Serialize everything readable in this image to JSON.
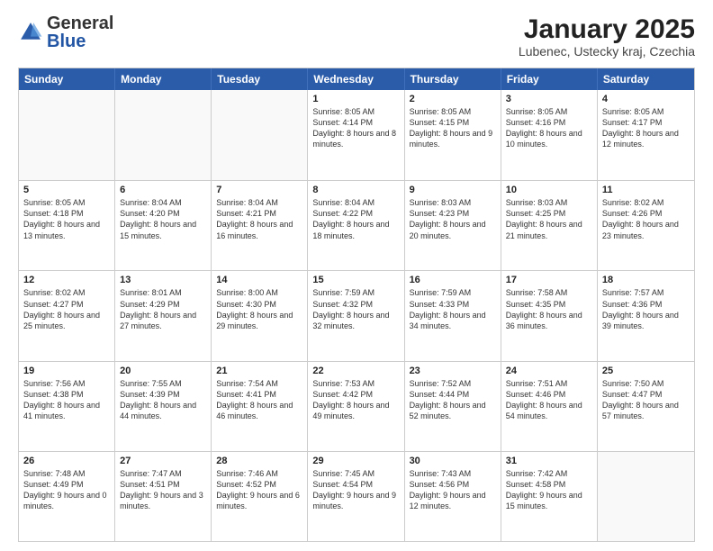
{
  "header": {
    "logo": {
      "general": "General",
      "blue": "Blue"
    },
    "title": "January 2025",
    "location": "Lubenec, Ustecky kraj, Czechia"
  },
  "weekdays": [
    "Sunday",
    "Monday",
    "Tuesday",
    "Wednesday",
    "Thursday",
    "Friday",
    "Saturday"
  ],
  "weeks": [
    [
      {
        "day": "",
        "sunrise": "",
        "sunset": "",
        "daylight": "",
        "empty": true
      },
      {
        "day": "",
        "sunrise": "",
        "sunset": "",
        "daylight": "",
        "empty": true
      },
      {
        "day": "",
        "sunrise": "",
        "sunset": "",
        "daylight": "",
        "empty": true
      },
      {
        "day": "1",
        "sunrise": "Sunrise: 8:05 AM",
        "sunset": "Sunset: 4:14 PM",
        "daylight": "Daylight: 8 hours and 8 minutes.",
        "empty": false
      },
      {
        "day": "2",
        "sunrise": "Sunrise: 8:05 AM",
        "sunset": "Sunset: 4:15 PM",
        "daylight": "Daylight: 8 hours and 9 minutes.",
        "empty": false
      },
      {
        "day": "3",
        "sunrise": "Sunrise: 8:05 AM",
        "sunset": "Sunset: 4:16 PM",
        "daylight": "Daylight: 8 hours and 10 minutes.",
        "empty": false
      },
      {
        "day": "4",
        "sunrise": "Sunrise: 8:05 AM",
        "sunset": "Sunset: 4:17 PM",
        "daylight": "Daylight: 8 hours and 12 minutes.",
        "empty": false
      }
    ],
    [
      {
        "day": "5",
        "sunrise": "Sunrise: 8:05 AM",
        "sunset": "Sunset: 4:18 PM",
        "daylight": "Daylight: 8 hours and 13 minutes.",
        "empty": false
      },
      {
        "day": "6",
        "sunrise": "Sunrise: 8:04 AM",
        "sunset": "Sunset: 4:20 PM",
        "daylight": "Daylight: 8 hours and 15 minutes.",
        "empty": false
      },
      {
        "day": "7",
        "sunrise": "Sunrise: 8:04 AM",
        "sunset": "Sunset: 4:21 PM",
        "daylight": "Daylight: 8 hours and 16 minutes.",
        "empty": false
      },
      {
        "day": "8",
        "sunrise": "Sunrise: 8:04 AM",
        "sunset": "Sunset: 4:22 PM",
        "daylight": "Daylight: 8 hours and 18 minutes.",
        "empty": false
      },
      {
        "day": "9",
        "sunrise": "Sunrise: 8:03 AM",
        "sunset": "Sunset: 4:23 PM",
        "daylight": "Daylight: 8 hours and 20 minutes.",
        "empty": false
      },
      {
        "day": "10",
        "sunrise": "Sunrise: 8:03 AM",
        "sunset": "Sunset: 4:25 PM",
        "daylight": "Daylight: 8 hours and 21 minutes.",
        "empty": false
      },
      {
        "day": "11",
        "sunrise": "Sunrise: 8:02 AM",
        "sunset": "Sunset: 4:26 PM",
        "daylight": "Daylight: 8 hours and 23 minutes.",
        "empty": false
      }
    ],
    [
      {
        "day": "12",
        "sunrise": "Sunrise: 8:02 AM",
        "sunset": "Sunset: 4:27 PM",
        "daylight": "Daylight: 8 hours and 25 minutes.",
        "empty": false
      },
      {
        "day": "13",
        "sunrise": "Sunrise: 8:01 AM",
        "sunset": "Sunset: 4:29 PM",
        "daylight": "Daylight: 8 hours and 27 minutes.",
        "empty": false
      },
      {
        "day": "14",
        "sunrise": "Sunrise: 8:00 AM",
        "sunset": "Sunset: 4:30 PM",
        "daylight": "Daylight: 8 hours and 29 minutes.",
        "empty": false
      },
      {
        "day": "15",
        "sunrise": "Sunrise: 7:59 AM",
        "sunset": "Sunset: 4:32 PM",
        "daylight": "Daylight: 8 hours and 32 minutes.",
        "empty": false
      },
      {
        "day": "16",
        "sunrise": "Sunrise: 7:59 AM",
        "sunset": "Sunset: 4:33 PM",
        "daylight": "Daylight: 8 hours and 34 minutes.",
        "empty": false
      },
      {
        "day": "17",
        "sunrise": "Sunrise: 7:58 AM",
        "sunset": "Sunset: 4:35 PM",
        "daylight": "Daylight: 8 hours and 36 minutes.",
        "empty": false
      },
      {
        "day": "18",
        "sunrise": "Sunrise: 7:57 AM",
        "sunset": "Sunset: 4:36 PM",
        "daylight": "Daylight: 8 hours and 39 minutes.",
        "empty": false
      }
    ],
    [
      {
        "day": "19",
        "sunrise": "Sunrise: 7:56 AM",
        "sunset": "Sunset: 4:38 PM",
        "daylight": "Daylight: 8 hours and 41 minutes.",
        "empty": false
      },
      {
        "day": "20",
        "sunrise": "Sunrise: 7:55 AM",
        "sunset": "Sunset: 4:39 PM",
        "daylight": "Daylight: 8 hours and 44 minutes.",
        "empty": false
      },
      {
        "day": "21",
        "sunrise": "Sunrise: 7:54 AM",
        "sunset": "Sunset: 4:41 PM",
        "daylight": "Daylight: 8 hours and 46 minutes.",
        "empty": false
      },
      {
        "day": "22",
        "sunrise": "Sunrise: 7:53 AM",
        "sunset": "Sunset: 4:42 PM",
        "daylight": "Daylight: 8 hours and 49 minutes.",
        "empty": false
      },
      {
        "day": "23",
        "sunrise": "Sunrise: 7:52 AM",
        "sunset": "Sunset: 4:44 PM",
        "daylight": "Daylight: 8 hours and 52 minutes.",
        "empty": false
      },
      {
        "day": "24",
        "sunrise": "Sunrise: 7:51 AM",
        "sunset": "Sunset: 4:46 PM",
        "daylight": "Daylight: 8 hours and 54 minutes.",
        "empty": false
      },
      {
        "day": "25",
        "sunrise": "Sunrise: 7:50 AM",
        "sunset": "Sunset: 4:47 PM",
        "daylight": "Daylight: 8 hours and 57 minutes.",
        "empty": false
      }
    ],
    [
      {
        "day": "26",
        "sunrise": "Sunrise: 7:48 AM",
        "sunset": "Sunset: 4:49 PM",
        "daylight": "Daylight: 9 hours and 0 minutes.",
        "empty": false
      },
      {
        "day": "27",
        "sunrise": "Sunrise: 7:47 AM",
        "sunset": "Sunset: 4:51 PM",
        "daylight": "Daylight: 9 hours and 3 minutes.",
        "empty": false
      },
      {
        "day": "28",
        "sunrise": "Sunrise: 7:46 AM",
        "sunset": "Sunset: 4:52 PM",
        "daylight": "Daylight: 9 hours and 6 minutes.",
        "empty": false
      },
      {
        "day": "29",
        "sunrise": "Sunrise: 7:45 AM",
        "sunset": "Sunset: 4:54 PM",
        "daylight": "Daylight: 9 hours and 9 minutes.",
        "empty": false
      },
      {
        "day": "30",
        "sunrise": "Sunrise: 7:43 AM",
        "sunset": "Sunset: 4:56 PM",
        "daylight": "Daylight: 9 hours and 12 minutes.",
        "empty": false
      },
      {
        "day": "31",
        "sunrise": "Sunrise: 7:42 AM",
        "sunset": "Sunset: 4:58 PM",
        "daylight": "Daylight: 9 hours and 15 minutes.",
        "empty": false
      },
      {
        "day": "",
        "sunrise": "",
        "sunset": "",
        "daylight": "",
        "empty": true
      }
    ]
  ]
}
